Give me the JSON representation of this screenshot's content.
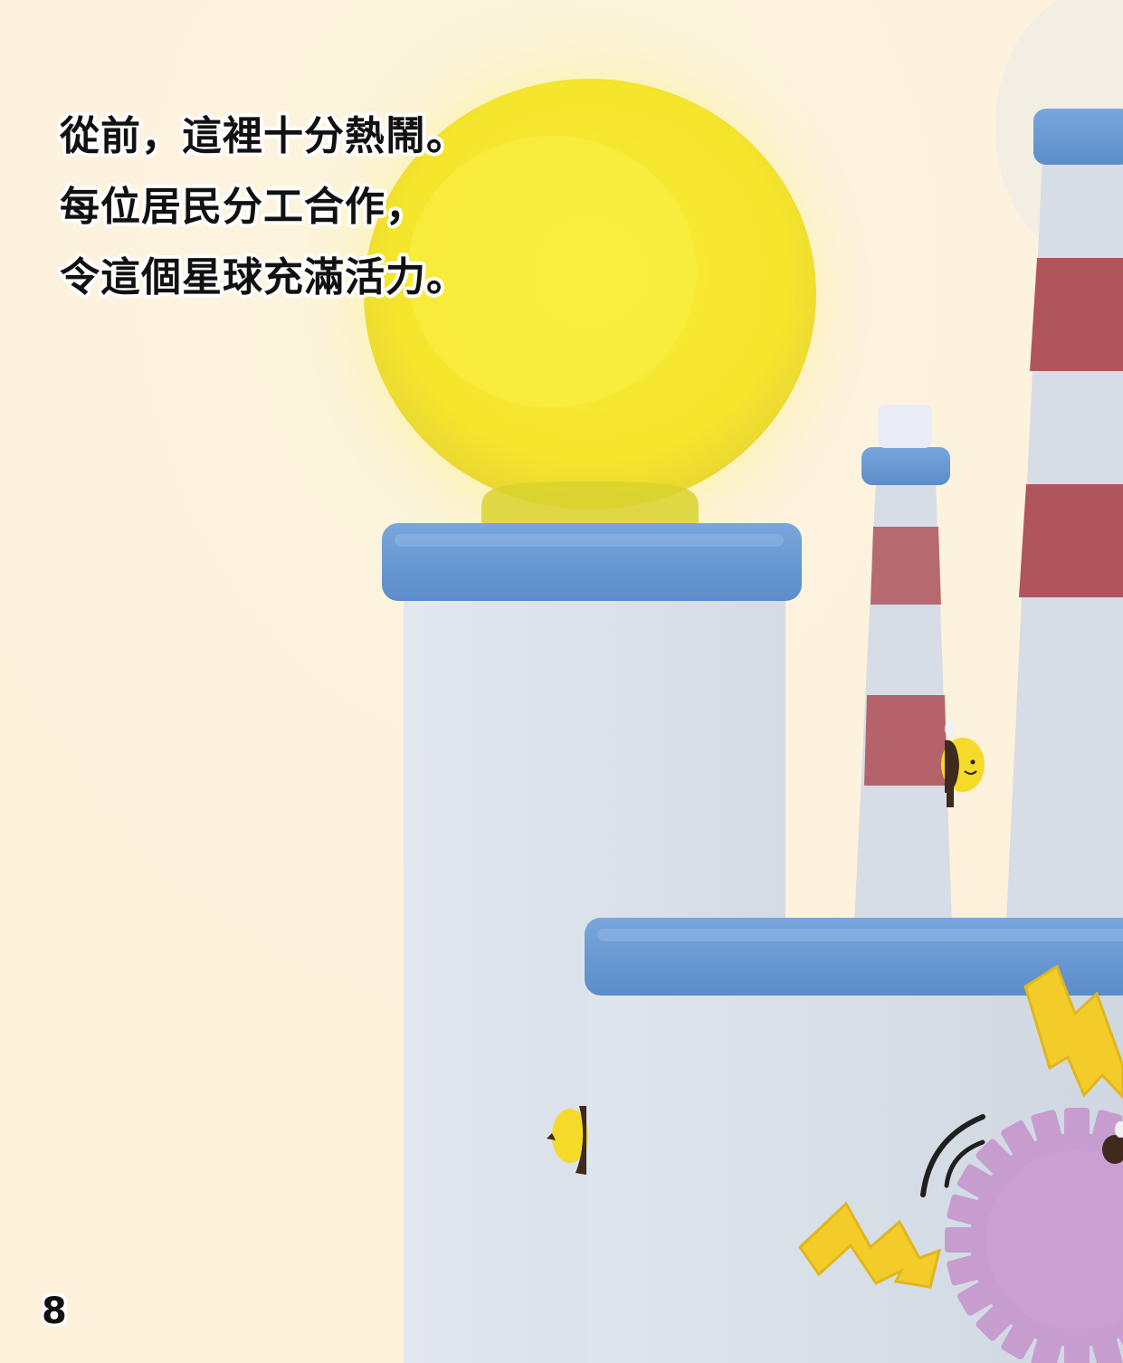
{
  "story": {
    "lines": [
      "從前，這裡十分熱鬧。",
      "每位居民分工合作，",
      "令這個星球充滿活力。"
    ]
  },
  "page_number": "8",
  "colors": {
    "background": "#fdf3df",
    "sun": "#f6e82c",
    "building_wall": "#d6dde6",
    "roof_blue": "#6a9ad3",
    "chimney_stripe_red": "#b0555c",
    "lightning_yellow": "#f3cc2a",
    "gear_purple": "#c79ccf",
    "bee_yellow": "#f6da2a",
    "bee_brown": "#3f2a1d"
  },
  "icons": [
    "sun",
    "factory-building",
    "chimney",
    "bee",
    "lightning-bolt",
    "gear",
    "sound-waves"
  ]
}
